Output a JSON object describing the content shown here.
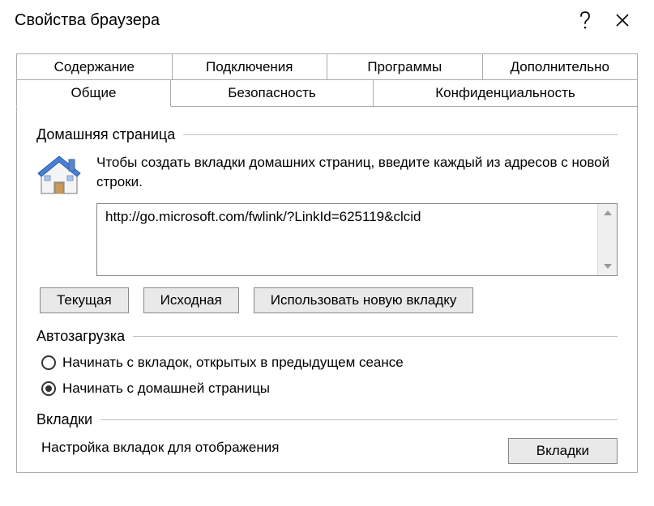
{
  "window": {
    "title": "Свойства браузера"
  },
  "tabs": {
    "row1": [
      "Содержание",
      "Подключения",
      "Программы",
      "Дополнительно"
    ],
    "row2": [
      "Общие",
      "Безопасность",
      "Конфиденциальность"
    ],
    "active": "Общие"
  },
  "homepage": {
    "group_label": "Домашняя страница",
    "description": "Чтобы создать вкладки домашних страниц, введите каждый из адресов с новой строки.",
    "url_value": "http://go.microsoft.com/fwlink/?LinkId=625119&clcid",
    "buttons": {
      "current": "Текущая",
      "default": "Исходная",
      "newtab": "Использовать новую вкладку"
    }
  },
  "startup": {
    "group_label": "Автозагрузка",
    "options": [
      {
        "label": "Начинать с вкладок, открытых в предыдущем сеансе",
        "checked": false
      },
      {
        "label": "Начинать с домашней страницы",
        "checked": true
      }
    ]
  },
  "tabs_section": {
    "group_label": "Вкладки",
    "description": "Настройка вкладок для отображения",
    "button": "Вкладки"
  }
}
